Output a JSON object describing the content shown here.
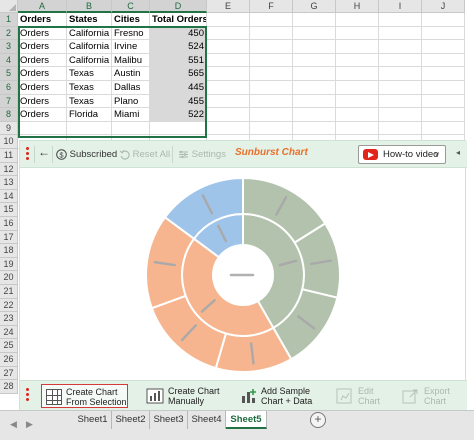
{
  "grid": {
    "columns": [
      "A",
      "B",
      "C",
      "D",
      "E",
      "F",
      "G",
      "H",
      "I",
      "J"
    ],
    "rows": [
      "1",
      "2",
      "3",
      "4",
      "5",
      "6",
      "7",
      "8",
      "9",
      "10",
      "11",
      "12",
      "13",
      "14",
      "15",
      "16",
      "17",
      "18",
      "19",
      "20",
      "21",
      "22",
      "23",
      "24",
      "25",
      "26",
      "27",
      "28"
    ],
    "header": [
      "Orders",
      "States",
      "Cities",
      "Total Orders"
    ],
    "data": [
      [
        "Orders",
        "California",
        "Fresno",
        "450"
      ],
      [
        "Orders",
        "California",
        "Irvine",
        "524"
      ],
      [
        "Orders",
        "California",
        "Malibu",
        "551"
      ],
      [
        "Orders",
        "Texas",
        "Austin",
        "565"
      ],
      [
        "Orders",
        "Texas",
        "Dallas",
        "445"
      ],
      [
        "Orders",
        "Texas",
        "Plano",
        "455"
      ],
      [
        "Orders",
        "Florida",
        "Miami",
        "522"
      ]
    ]
  },
  "toolbar": {
    "subscribed": "Subscribed",
    "reset_all": "Reset All",
    "settings": "Settings",
    "chart_title": "Sunburst Chart",
    "how_to": "How-to video"
  },
  "bottom": {
    "create_selection": [
      "Create Chart",
      "From Selection"
    ],
    "create_manually": [
      "Create Chart",
      "Manually"
    ],
    "add_sample": [
      "Add Sample",
      "Chart + Data"
    ],
    "edit_chart": [
      "Edit",
      "Chart"
    ],
    "export_chart": [
      "Export",
      "Chart"
    ]
  },
  "tabs": [
    "Sheet1",
    "Sheet2",
    "Sheet3",
    "Sheet4",
    "Sheet5"
  ],
  "active_tab": "Sheet5",
  "colors": {
    "accent_green": "#217346",
    "toolbar_bg": "#e4f1e7",
    "title_orange": "#e8702a",
    "youtube_red": "#e1251b"
  },
  "chart_data": {
    "type": "sunburst",
    "title": "",
    "center": "Orders",
    "total": 3512,
    "groups": [
      {
        "name": "California",
        "value": 1525,
        "color": "#f6b58e"
      },
      {
        "name": "Texas",
        "value": 1465,
        "color": "#b3c2ad"
      },
      {
        "name": "Florida",
        "value": 522,
        "color": "#9fc4ea"
      }
    ],
    "children": [
      {
        "name": "Fresno",
        "parent": "California",
        "value": 450
      },
      {
        "name": "Irvine",
        "parent": "California",
        "value": 524
      },
      {
        "name": "Malibu",
        "parent": "California",
        "value": 551
      },
      {
        "name": "Austin",
        "parent": "Texas",
        "value": 565
      },
      {
        "name": "Dallas",
        "parent": "Texas",
        "value": 445
      },
      {
        "name": "Plano",
        "parent": "Texas",
        "value": 455
      },
      {
        "name": "Miami",
        "parent": "Florida",
        "value": 522
      }
    ]
  }
}
